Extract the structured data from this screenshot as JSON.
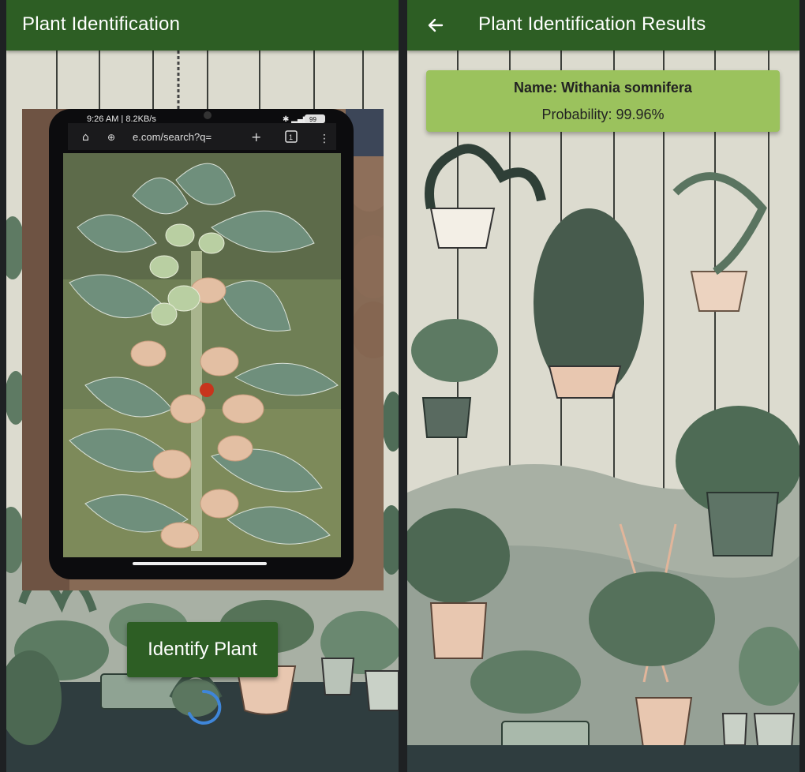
{
  "identify_screen": {
    "title": "Plant Identification",
    "identify_button_label": "Identify Plant",
    "photo": {
      "status_time": "9:26 AM | 8.2KB/s",
      "url_text": "e.com/search?q=",
      "battery": "99",
      "tab_count": "1"
    }
  },
  "results_screen": {
    "title": "Plant Identification Results",
    "result": {
      "name_text": "Name: Withania somnifera",
      "probability_text": "Probability: 99.96%"
    }
  },
  "colors": {
    "appbar": "#2d5e24",
    "result_card": "#9bc25d",
    "background": "#dcdbcf"
  }
}
